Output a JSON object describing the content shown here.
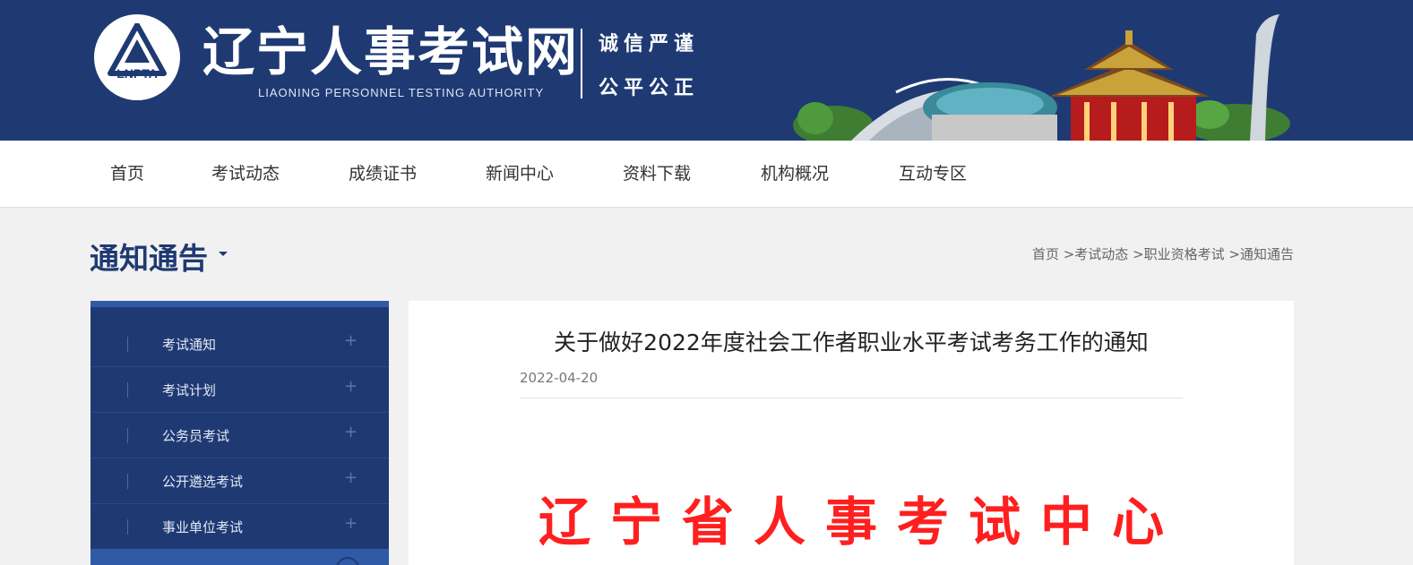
{
  "header": {
    "logo_abbr": "LNPTA",
    "site_title": "辽宁人事考试网",
    "site_subtitle": "LIAONING PERSONNEL TESTING AUTHORITY",
    "motto_line1": "诚信严谨",
    "motto_line2": "公平公正"
  },
  "nav": {
    "items": [
      "首页",
      "考试动态",
      "成绩证书",
      "新闻中心",
      "资料下载",
      "机构概况",
      "互动专区"
    ]
  },
  "section": {
    "title": "通知通告"
  },
  "breadcrumb": {
    "items": [
      "首页 >",
      "考试动态 >",
      "职业资格考试 >",
      "通知通告"
    ]
  },
  "sidebar": {
    "items": [
      "考试通知",
      "考试计划",
      "公务员考试",
      "公开遴选考试",
      "事业单位考试"
    ],
    "expand_symbol": "+"
  },
  "article": {
    "title": "关于做好2022年度社会工作者职业水平考试考务工作的通知",
    "date": "2022-04-20",
    "doc_header": "辽宁省人事考试中心"
  },
  "colors": {
    "brand_navy": "#1f3a73",
    "accent_blue": "#2e5aa6",
    "doc_red": "#ff1f1f"
  }
}
